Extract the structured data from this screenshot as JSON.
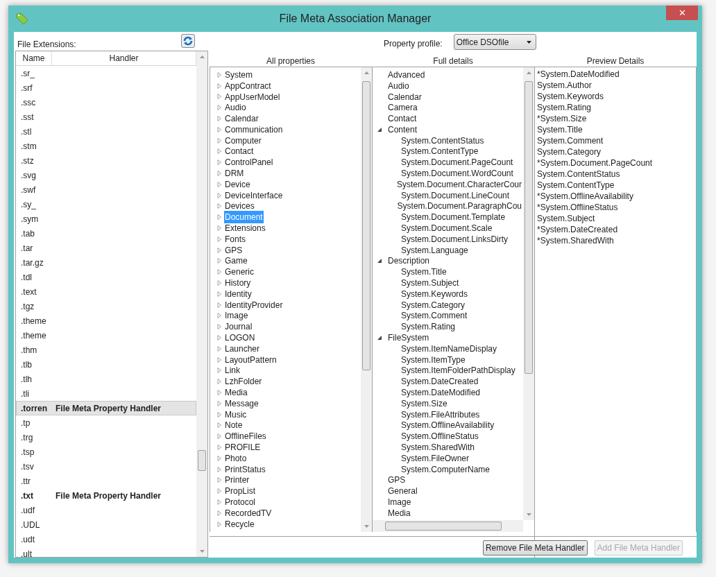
{
  "window": {
    "title": "File Meta Association Manager",
    "close": "✕"
  },
  "extensions": {
    "label": "File Extensions:",
    "columns": [
      "Name",
      "Handler"
    ],
    "rows": [
      {
        "name": ".sr_",
        "selected": false
      },
      {
        "name": ".srf",
        "selected": false
      },
      {
        "name": ".ssc",
        "selected": false
      },
      {
        "name": ".sst",
        "selected": false
      },
      {
        "name": ".stl",
        "selected": false
      },
      {
        "name": ".stm",
        "selected": false
      },
      {
        "name": ".stz",
        "selected": false
      },
      {
        "name": ".svg",
        "selected": false
      },
      {
        "name": ".swf",
        "selected": false
      },
      {
        "name": ".sy_",
        "selected": false
      },
      {
        "name": ".sym",
        "selected": false
      },
      {
        "name": ".tab",
        "selected": false
      },
      {
        "name": ".tar",
        "selected": false
      },
      {
        "name": ".tar.gz",
        "selected": false
      },
      {
        "name": ".tdl",
        "selected": false
      },
      {
        "name": ".text",
        "selected": false
      },
      {
        "name": ".tgz",
        "selected": false
      },
      {
        "name": ".theme",
        "selected": false
      },
      {
        "name": ".theme",
        "selected": false
      },
      {
        "name": ".thm",
        "selected": false
      },
      {
        "name": ".tlb",
        "selected": false
      },
      {
        "name": ".tlh",
        "selected": false
      },
      {
        "name": ".tli",
        "selected": false
      },
      {
        "name": ".torren",
        "handler": "File Meta Property Handler",
        "selected": true
      },
      {
        "name": ".tp",
        "selected": false
      },
      {
        "name": ".trg",
        "selected": false
      },
      {
        "name": ".tsp",
        "selected": false
      },
      {
        "name": ".tsv",
        "selected": false
      },
      {
        "name": ".ttr",
        "selected": false
      },
      {
        "name": ".txt",
        "handler": "File Meta Property Handler",
        "selected": false
      },
      {
        "name": ".udf",
        "selected": false
      },
      {
        "name": ".UDL",
        "selected": false
      },
      {
        "name": ".udt",
        "selected": false
      },
      {
        "name": ".ult",
        "selected": false
      }
    ]
  },
  "profile": {
    "label": "Property profile:",
    "value": "Office DSOfile"
  },
  "all_properties": {
    "heading": "All properties",
    "items": [
      {
        "label": "System",
        "selected": false
      },
      {
        "label": "AppContract",
        "selected": false
      },
      {
        "label": "AppUserModel",
        "selected": false
      },
      {
        "label": "Audio",
        "selected": false
      },
      {
        "label": "Calendar",
        "selected": false
      },
      {
        "label": "Communication",
        "selected": false
      },
      {
        "label": "Computer",
        "selected": false
      },
      {
        "label": "Contact",
        "selected": false
      },
      {
        "label": "ControlPanel",
        "selected": false
      },
      {
        "label": "DRM",
        "selected": false
      },
      {
        "label": "Device",
        "selected": false
      },
      {
        "label": "DeviceInterface",
        "selected": false
      },
      {
        "label": "Devices",
        "selected": false
      },
      {
        "label": "Document",
        "selected": true
      },
      {
        "label": "Extensions",
        "selected": false
      },
      {
        "label": "Fonts",
        "selected": false
      },
      {
        "label": "GPS",
        "selected": false
      },
      {
        "label": "Game",
        "selected": false
      },
      {
        "label": "Generic",
        "selected": false
      },
      {
        "label": "History",
        "selected": false
      },
      {
        "label": "Identity",
        "selected": false
      },
      {
        "label": "IdentityProvider",
        "selected": false
      },
      {
        "label": "Image",
        "selected": false
      },
      {
        "label": "Journal",
        "selected": false
      },
      {
        "label": "LOGON",
        "selected": false
      },
      {
        "label": "Launcher",
        "selected": false
      },
      {
        "label": "LayoutPattern",
        "selected": false
      },
      {
        "label": "Link",
        "selected": false
      },
      {
        "label": "LzhFolder",
        "selected": false
      },
      {
        "label": "Media",
        "selected": false
      },
      {
        "label": "Message",
        "selected": false
      },
      {
        "label": "Music",
        "selected": false
      },
      {
        "label": "Note",
        "selected": false
      },
      {
        "label": "OfflineFiles",
        "selected": false
      },
      {
        "label": "PROFILE",
        "selected": false
      },
      {
        "label": "Photo",
        "selected": false
      },
      {
        "label": "PrintStatus",
        "selected": false
      },
      {
        "label": "Printer",
        "selected": false
      },
      {
        "label": "PropList",
        "selected": false
      },
      {
        "label": "Protocol",
        "selected": false
      },
      {
        "label": "RecordedTV",
        "selected": false
      },
      {
        "label": "Recycle",
        "selected": false
      }
    ]
  },
  "full_details": {
    "heading": "Full details",
    "items": [
      {
        "label": "Advanced"
      },
      {
        "label": "Audio"
      },
      {
        "label": "Calendar"
      },
      {
        "label": "Camera"
      },
      {
        "label": "Contact"
      },
      {
        "label": "Content",
        "expanded": true,
        "children": [
          {
            "label": "System.ContentStatus"
          },
          {
            "label": "System.ContentType"
          },
          {
            "label": "System.Document.PageCount"
          },
          {
            "label": "System.Document.WordCount"
          },
          {
            "label": "System.Document.CharacterCour"
          },
          {
            "label": "System.Document.LineCount"
          },
          {
            "label": "System.Document.ParagraphCou"
          },
          {
            "label": "System.Document.Template"
          },
          {
            "label": "System.Document.Scale"
          },
          {
            "label": "System.Document.LinksDirty"
          },
          {
            "label": "System.Language"
          }
        ]
      },
      {
        "label": "Description",
        "expanded": true,
        "children": [
          {
            "label": "System.Title"
          },
          {
            "label": "System.Subject"
          },
          {
            "label": "System.Keywords"
          },
          {
            "label": "System.Category"
          },
          {
            "label": "System.Comment"
          },
          {
            "label": "System.Rating"
          }
        ]
      },
      {
        "label": "FileSystem",
        "expanded": true,
        "children": [
          {
            "label": "System.ItemNameDisplay"
          },
          {
            "label": "System.ItemType"
          },
          {
            "label": "System.ItemFolderPathDisplay"
          },
          {
            "label": "System.DateCreated"
          },
          {
            "label": "System.DateModified"
          },
          {
            "label": "System.Size"
          },
          {
            "label": "System.FileAttributes"
          },
          {
            "label": "System.OfflineAvailability"
          },
          {
            "label": "System.OfflineStatus"
          },
          {
            "label": "System.SharedWith"
          },
          {
            "label": "System.FileOwner"
          },
          {
            "label": "System.ComputerName"
          }
        ]
      },
      {
        "label": "GPS"
      },
      {
        "label": "General"
      },
      {
        "label": "Image"
      },
      {
        "label": "Media"
      }
    ]
  },
  "preview_details": {
    "heading": "Preview Details",
    "items": [
      "*System.DateModified",
      "System.Author",
      "System.Keywords",
      "System.Rating",
      "*System.Size",
      "System.Title",
      "System.Comment",
      "System.Category",
      "*System.Document.PageCount",
      "System.ContentStatus",
      "System.ContentType",
      "*System.OfflineAvailability",
      "*System.OfflineStatus",
      "System.Subject",
      "*System.DateCreated",
      "*System.SharedWith"
    ]
  },
  "buttons": [
    {
      "label": "Remove File Meta Handler",
      "disabled": false
    },
    {
      "label": "Add File Meta Handler",
      "disabled": true
    }
  ]
}
